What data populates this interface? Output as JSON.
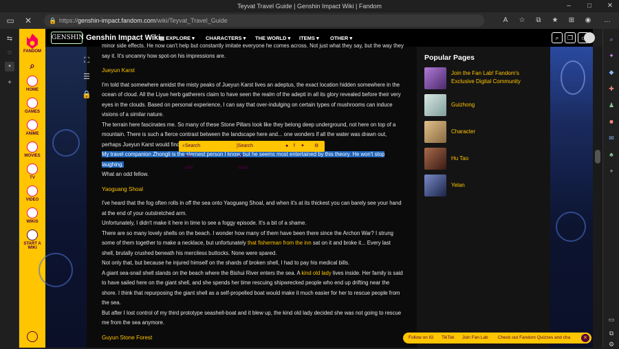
{
  "browser": {
    "window_title": "Teyvat Travel Guide | Genshin Impact Wiki | Fandom",
    "url_prefix": "https://",
    "url_host": "genshin-impact.fandom.com",
    "url_path": "/wiki/Teyvat_Travel_Guide"
  },
  "rail": {
    "brand": "FANDOM",
    "items": [
      {
        "label": "HOME"
      },
      {
        "label": "GAMES"
      },
      {
        "label": "ANIME"
      },
      {
        "label": "MOVIES"
      },
      {
        "label": "TV"
      },
      {
        "label": "VIDEO"
      },
      {
        "label": "WIKIS"
      },
      {
        "label": "START A WIKI"
      }
    ]
  },
  "wikinav": {
    "logo_text": "GENSHIN",
    "wiki_name": "Genshin Impact Wiki",
    "menus": [
      "EXPLORE",
      "CHARACTERS",
      "THE WORLD",
      "ITEMS",
      "OTHER"
    ]
  },
  "article": {
    "top_partial": "minor side effects. He now can't help but constantly imitate everyone he comes across. Not just what they say, but the way they say it. It's uncanny how spot-on his impressions are.",
    "section1_title": "Jueyun Karst",
    "s1_p1": "I'm told that somewhere amidst the misty peaks of Jueyun Karst lives an adeptus, the exact location hidden somewhere in the ocean of cloud. All the Liyue herb gatherers claim to have seen the realm of the adepti in all its glory revealed before their very eyes in the clouds. Based on personal experience, I can say that over-indulging on certain types of mushrooms can induce visions of a similar nature.",
    "s1_p2": "The terrain here fascinates me. So many of these Stone Pillars look like they belong deep underground, not here on top of a mountain. There is such a fierce contrast between the landscape here and... one wonders if all the water was drawn out, perhaps Jueyun Karst would find itself back on the ocean floor where it belongs.",
    "s1_highlight": "My travel companion Zhongli is the sternest person I know, but he seems most entertained by this theory. He won't stop laughing.",
    "s1_p3": "What an odd fellow.",
    "section2_title": "Yaoguang Shoal",
    "s2_p1": "I've heard that the fog often rolls in off the sea onto Yaoguang Shoal, and when it's at its thickest you can barely see your hand at the end of your outstretched arm.",
    "s2_p2": "Unfortunately, I didn't make it here in time to see a foggy episode. It's a bit of a shame.",
    "s2_p3a": "There are so many lovely shells on the beach. I wonder how many of them have been there since the Archon War? I strung some of them together to make a necklace, but unfortunately ",
    "s2_p3_link": "that fisherman from the inn",
    "s2_p3b": " sat on it and broke it... Every last shell, brutally crushed beneath his merciless buttocks. None were spared.",
    "s2_p4": "Not only that, but because he injured himself on the shards of broken shell, I had to pay his medical bills.",
    "s2_p5a": "A giant sea-snail shell stands on the beach where the Bishui River enters the sea. A ",
    "s2_p5_link": "kind old lady",
    "s2_p5b": " lives inside. Her family is said to have sailed here on the giant shell, and she spends her time rescuing shipwrecked people who end up drifting near the shore. I think that repurposing the giant shell as a self-propelled boat would make it much easier for her to rescue people from the sea.",
    "s2_p6": "But after I lost control of my third prototype seashell-boat and it blew up, the kind old lady decided she was not going to rescue me from the sea anymore.",
    "section3_title": "Guyun Stone Forest"
  },
  "selection_toolbar": {
    "search_wiki": "Search this wiki",
    "search_all": "Search all wikis"
  },
  "popular": {
    "title": "Popular Pages",
    "items": [
      {
        "label": "Join the Fan Lab! Fandom's Exclusive Digital Community",
        "color": "#7a4aa8"
      },
      {
        "label": "Guizhong",
        "color": "#9fb7b5"
      },
      {
        "label": "Character",
        "color": "#c8a06a"
      },
      {
        "label": "Hu Tao",
        "color": "#6a3a2a"
      },
      {
        "label": "Yelan",
        "color": "#3a4a7a"
      }
    ]
  },
  "fandom_bar": {
    "items": [
      "Follow on IG",
      "TikTok",
      "Join Fan Lab",
      "Check out Fandom Quizzes and cha"
    ]
  }
}
